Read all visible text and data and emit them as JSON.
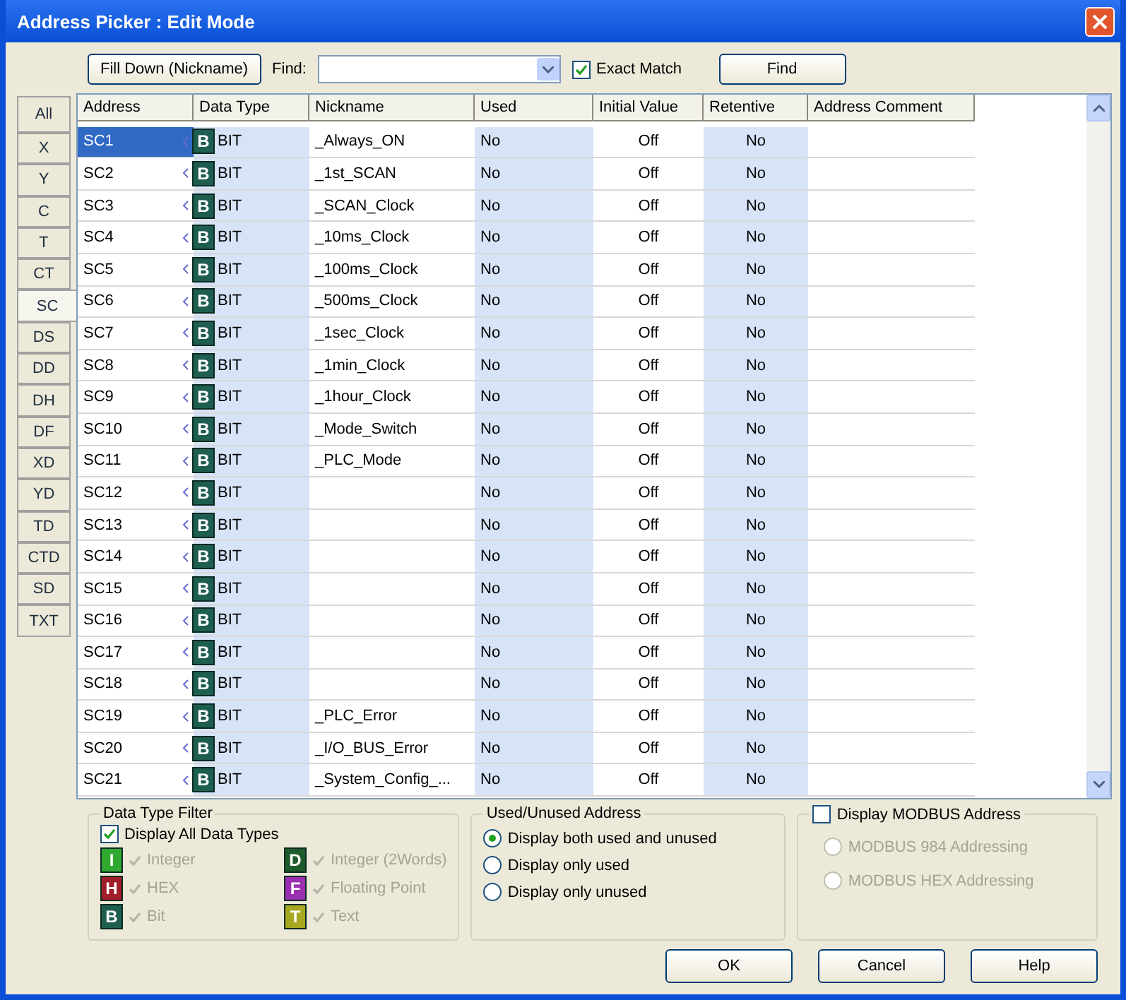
{
  "window": {
    "title": "Address Picker : Edit Mode"
  },
  "toolbar": {
    "fill_down_button": "Fill Down (Nickname)",
    "find_label": "Find:",
    "exact_match": {
      "label": "Exact Match",
      "checked": true
    },
    "find_button": "Find"
  },
  "type_tabs": [
    {
      "label": "All",
      "selected": false
    },
    {
      "label": "X",
      "selected": false
    },
    {
      "label": "Y",
      "selected": false
    },
    {
      "label": "C",
      "selected": false
    },
    {
      "label": "T",
      "selected": false
    },
    {
      "label": "CT",
      "selected": false
    },
    {
      "label": "SC",
      "selected": true
    },
    {
      "label": "DS",
      "selected": false
    },
    {
      "label": "DD",
      "selected": false
    },
    {
      "label": "DH",
      "selected": false
    },
    {
      "label": "DF",
      "selected": false
    },
    {
      "label": "XD",
      "selected": false
    },
    {
      "label": "YD",
      "selected": false
    },
    {
      "label": "TD",
      "selected": false
    },
    {
      "label": "CTD",
      "selected": false
    },
    {
      "label": "SD",
      "selected": false
    },
    {
      "label": "TXT",
      "selected": false
    }
  ],
  "table": {
    "columns": [
      "Address",
      "Data Type",
      "Nickname",
      "Used",
      "Initial Value",
      "Retentive",
      "Address Comment"
    ],
    "rows": [
      {
        "address": "SC1",
        "type_letter": "B",
        "data_type": "BIT",
        "nickname": "_Always_ON",
        "used": "No",
        "initial_value": "Off",
        "retentive": "No",
        "selected": true
      },
      {
        "address": "SC2",
        "type_letter": "B",
        "data_type": "BIT",
        "nickname": "_1st_SCAN",
        "used": "No",
        "initial_value": "Off",
        "retentive": "No",
        "selected": false
      },
      {
        "address": "SC3",
        "type_letter": "B",
        "data_type": "BIT",
        "nickname": "_SCAN_Clock",
        "used": "No",
        "initial_value": "Off",
        "retentive": "No",
        "selected": false
      },
      {
        "address": "SC4",
        "type_letter": "B",
        "data_type": "BIT",
        "nickname": "_10ms_Clock",
        "used": "No",
        "initial_value": "Off",
        "retentive": "No",
        "selected": false
      },
      {
        "address": "SC5",
        "type_letter": "B",
        "data_type": "BIT",
        "nickname": "_100ms_Clock",
        "used": "No",
        "initial_value": "Off",
        "retentive": "No",
        "selected": false
      },
      {
        "address": "SC6",
        "type_letter": "B",
        "data_type": "BIT",
        "nickname": "_500ms_Clock",
        "used": "No",
        "initial_value": "Off",
        "retentive": "No",
        "selected": false
      },
      {
        "address": "SC7",
        "type_letter": "B",
        "data_type": "BIT",
        "nickname": "_1sec_Clock",
        "used": "No",
        "initial_value": "Off",
        "retentive": "No",
        "selected": false
      },
      {
        "address": "SC8",
        "type_letter": "B",
        "data_type": "BIT",
        "nickname": "_1min_Clock",
        "used": "No",
        "initial_value": "Off",
        "retentive": "No",
        "selected": false
      },
      {
        "address": "SC9",
        "type_letter": "B",
        "data_type": "BIT",
        "nickname": "_1hour_Clock",
        "used": "No",
        "initial_value": "Off",
        "retentive": "No",
        "selected": false
      },
      {
        "address": "SC10",
        "type_letter": "B",
        "data_type": "BIT",
        "nickname": "_Mode_Switch",
        "used": "No",
        "initial_value": "Off",
        "retentive": "No",
        "selected": false
      },
      {
        "address": "SC11",
        "type_letter": "B",
        "data_type": "BIT",
        "nickname": "_PLC_Mode",
        "used": "No",
        "initial_value": "Off",
        "retentive": "No",
        "selected": false
      },
      {
        "address": "SC12",
        "type_letter": "B",
        "data_type": "BIT",
        "nickname": "",
        "used": "No",
        "initial_value": "Off",
        "retentive": "No",
        "selected": false
      },
      {
        "address": "SC13",
        "type_letter": "B",
        "data_type": "BIT",
        "nickname": "",
        "used": "No",
        "initial_value": "Off",
        "retentive": "No",
        "selected": false
      },
      {
        "address": "SC14",
        "type_letter": "B",
        "data_type": "BIT",
        "nickname": "",
        "used": "No",
        "initial_value": "Off",
        "retentive": "No",
        "selected": false
      },
      {
        "address": "SC15",
        "type_letter": "B",
        "data_type": "BIT",
        "nickname": "",
        "used": "No",
        "initial_value": "Off",
        "retentive": "No",
        "selected": false
      },
      {
        "address": "SC16",
        "type_letter": "B",
        "data_type": "BIT",
        "nickname": "",
        "used": "No",
        "initial_value": "Off",
        "retentive": "No",
        "selected": false
      },
      {
        "address": "SC17",
        "type_letter": "B",
        "data_type": "BIT",
        "nickname": "",
        "used": "No",
        "initial_value": "Off",
        "retentive": "No",
        "selected": false
      },
      {
        "address": "SC18",
        "type_letter": "B",
        "data_type": "BIT",
        "nickname": "",
        "used": "No",
        "initial_value": "Off",
        "retentive": "No",
        "selected": false
      },
      {
        "address": "SC19",
        "type_letter": "B",
        "data_type": "BIT",
        "nickname": "_PLC_Error",
        "used": "No",
        "initial_value": "Off",
        "retentive": "No",
        "selected": false
      },
      {
        "address": "SC20",
        "type_letter": "B",
        "data_type": "BIT",
        "nickname": "_I/O_BUS_Error",
        "used": "No",
        "initial_value": "Off",
        "retentive": "No",
        "selected": false
      },
      {
        "address": "SC21",
        "type_letter": "B",
        "data_type": "BIT",
        "nickname": "_System_Config_...",
        "used": "No",
        "initial_value": "Off",
        "retentive": "No",
        "selected": false
      }
    ]
  },
  "data_type_filter": {
    "title": "Data Type Filter",
    "display_all": {
      "label": "Display All Data Types",
      "checked": true
    },
    "types": [
      {
        "letter": "I",
        "label": "Integer",
        "color": "#2fa82f",
        "checked": true
      },
      {
        "letter": "D",
        "label": "Integer (2Words)",
        "color": "#1f5a2a",
        "checked": true
      },
      {
        "letter": "H",
        "label": "HEX",
        "color": "#a01c28",
        "checked": true
      },
      {
        "letter": "F",
        "label": "Floating Point",
        "color": "#9a2fb0",
        "checked": true
      },
      {
        "letter": "B",
        "label": "Bit",
        "color": "#1e5e50",
        "checked": true
      },
      {
        "letter": "T",
        "label": "Text",
        "color": "#a8a820",
        "checked": true
      }
    ]
  },
  "used_unused": {
    "title": "Used/Unused Address",
    "options": [
      {
        "label": "Display both used and unused",
        "selected": true
      },
      {
        "label": "Display only used",
        "selected": false
      },
      {
        "label": "Display only unused",
        "selected": false
      }
    ]
  },
  "modbus": {
    "label": "Display MODBUS Address",
    "checked": false,
    "options": [
      {
        "label": "MODBUS 984 Addressing",
        "selected": false,
        "disabled": true
      },
      {
        "label": "MODBUS HEX Addressing",
        "selected": false,
        "disabled": true
      }
    ]
  },
  "buttons": [
    "OK",
    "Cancel",
    "Help"
  ]
}
